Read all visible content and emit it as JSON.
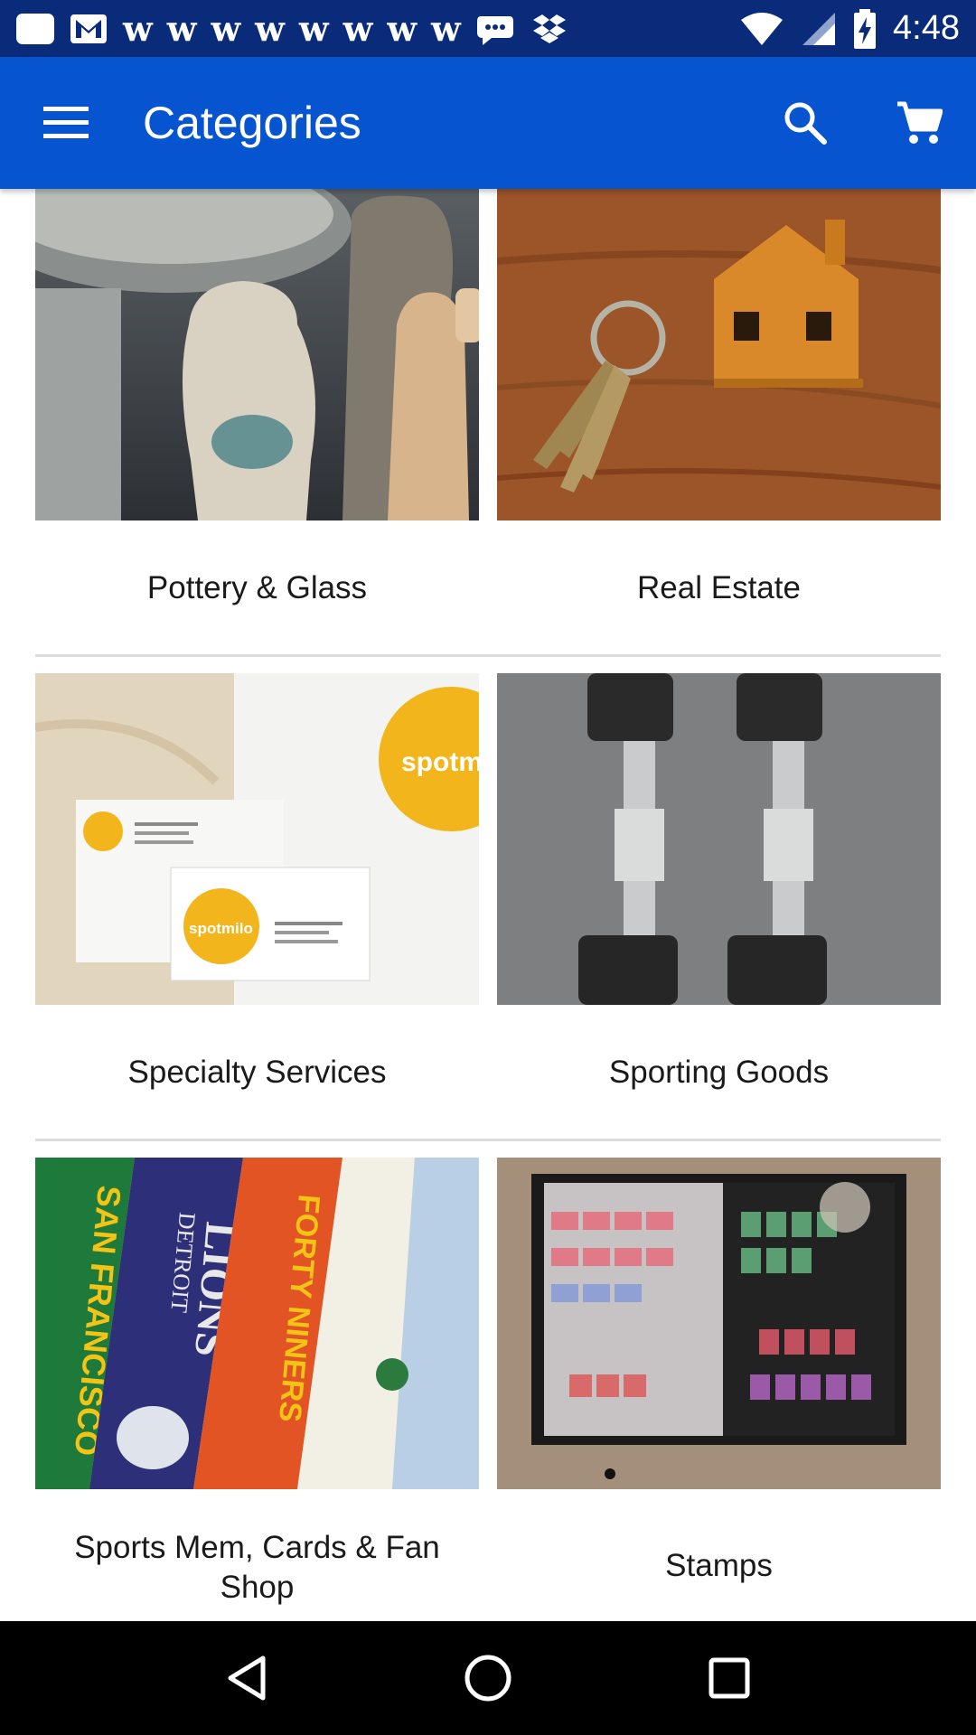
{
  "status_bar": {
    "time": "4:48",
    "icons": [
      "messages-icon",
      "gmail-icon",
      "w-icon",
      "w-icon",
      "w-icon",
      "w-icon",
      "w-icon",
      "w-icon",
      "w-icon",
      "w-icon",
      "chat-icon",
      "dropbox-icon"
    ],
    "w_glyph": "w"
  },
  "app_bar": {
    "title": "Categories",
    "color": "#0654d0"
  },
  "categories": [
    {
      "label": "Pottery & Glass",
      "image": "pottery-image"
    },
    {
      "label": "Real Estate",
      "image": "house-keys-image"
    },
    {
      "label": "Specialty Services",
      "image": "business-cards-image"
    },
    {
      "label": "Sporting Goods",
      "image": "dumbbells-image"
    },
    {
      "label": "Sports Mem, Cards & Fan Shop",
      "image": "pennants-image"
    },
    {
      "label": "Stamps",
      "image": "stamp-album-image"
    }
  ],
  "images": {
    "business_cards_text": "spotmilo",
    "business_cards_partial": "spotm",
    "pennant_1": "SAN FRANCISCO",
    "pennant_2": "DETROIT",
    "pennant_3": "LIONS",
    "pennant_4": "FORTY NINERS"
  }
}
